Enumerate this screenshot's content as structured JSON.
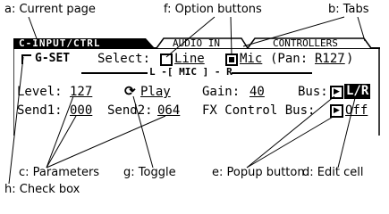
{
  "annotations": {
    "current_page": "a: Current page",
    "option_buttons": "f: Option buttons",
    "tabs": "b: Tabs",
    "parameters": "c: Parameters",
    "toggle": "g: Toggle",
    "popup_button": "e: Popup button",
    "edit_cell": "d: Edit cell",
    "check_box": "h: Check box"
  },
  "screen": {
    "page_title": "C-INPUT/CTRL",
    "tabs": [
      "AUDIO IN",
      "CONTROLLERS"
    ],
    "g_set_label": "G-SET",
    "select_label": "Select:",
    "options": [
      {
        "label": "Line",
        "selected": false
      },
      {
        "label": "Mic",
        "selected": true
      }
    ],
    "pan_label": "(Pan:",
    "pan_value": "R127",
    "pan_close": ")",
    "meter_label": "L -[ MIC ] - R",
    "level_label": "Level:",
    "level_value": "127",
    "play_label": "Play",
    "gain_label": "Gain:",
    "gain_value": "40",
    "bus_label": "Bus:",
    "bus_value": "L/R",
    "send1_label": "Send1:",
    "send1_value": "000",
    "send2_label": "Send2:",
    "send2_value": "064",
    "fx_label": "FX Control Bus:",
    "fx_value": "Off"
  }
}
